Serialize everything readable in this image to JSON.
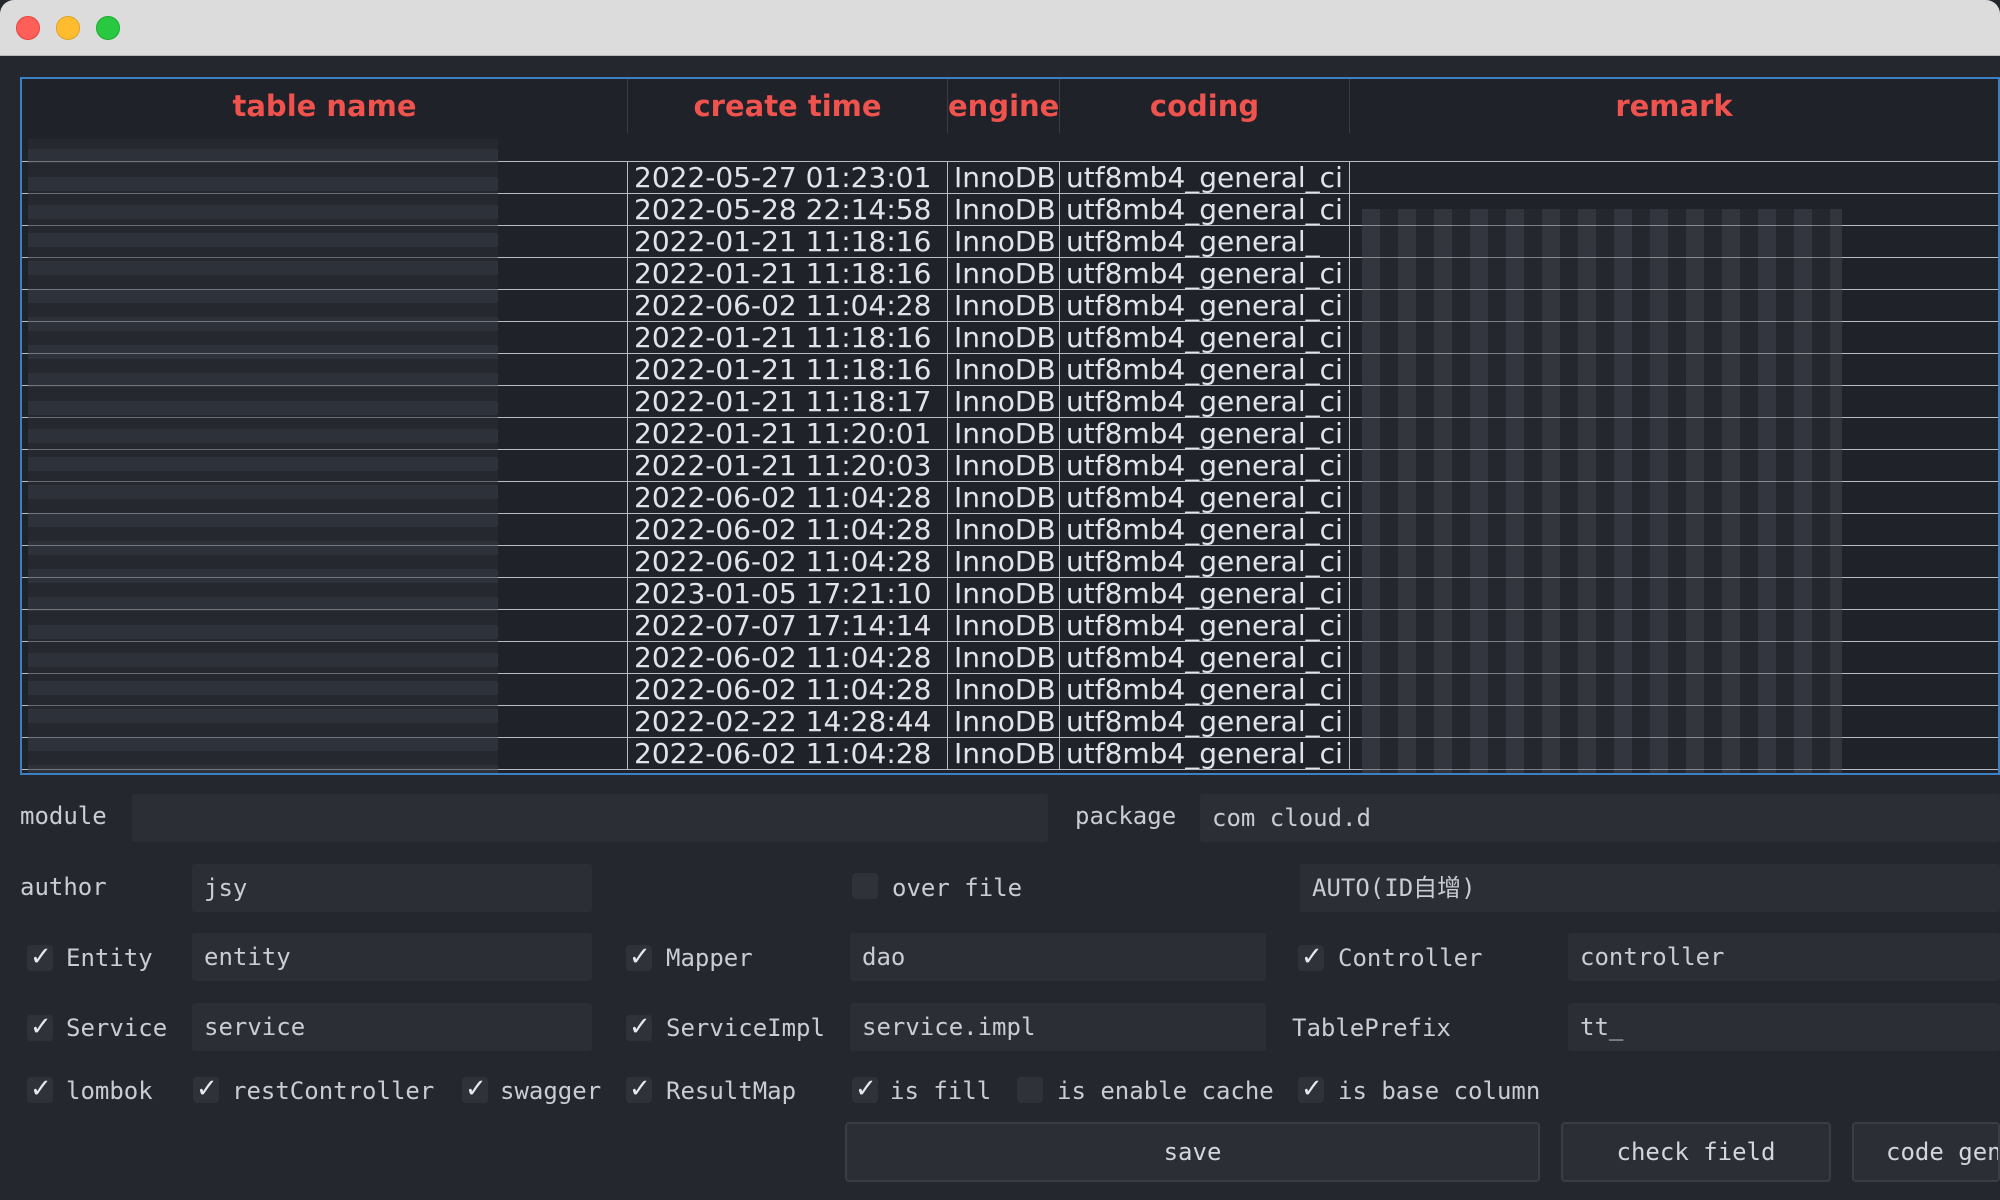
{
  "table": {
    "headers": [
      "table name",
      "create time",
      "engine",
      "coding",
      "remark"
    ],
    "rows": [
      {
        "time": "2022-05-27 01:23:01",
        "engine": "InnoDB",
        "coding": "utf8mb4_general_ci"
      },
      {
        "time": "2022-05-28 22:14:58",
        "engine": "InnoDB",
        "coding": "utf8mb4_general_ci"
      },
      {
        "time": "2022-01-21 11:18:16",
        "engine": "InnoDB",
        "coding": "utf8mb4_general_"
      },
      {
        "time": "2022-01-21 11:18:16",
        "engine": "InnoDB",
        "coding": "utf8mb4_general_ci"
      },
      {
        "time": "2022-06-02 11:04:28",
        "engine": "InnoDB",
        "coding": "utf8mb4_general_ci"
      },
      {
        "time": "2022-01-21 11:18:16",
        "engine": "InnoDB",
        "coding": "utf8mb4_general_ci"
      },
      {
        "time": "2022-01-21 11:18:16",
        "engine": "InnoDB",
        "coding": "utf8mb4_general_ci"
      },
      {
        "time": "2022-01-21 11:18:17",
        "engine": "InnoDB",
        "coding": "utf8mb4_general_ci"
      },
      {
        "time": "2022-01-21 11:20:01",
        "engine": "InnoDB",
        "coding": "utf8mb4_general_ci"
      },
      {
        "time": "2022-01-21 11:20:03",
        "engine": "InnoDB",
        "coding": "utf8mb4_general_ci"
      },
      {
        "time": "2022-06-02 11:04:28",
        "engine": "InnoDB",
        "coding": "utf8mb4_general_ci"
      },
      {
        "time": "2022-06-02 11:04:28",
        "engine": "InnoDB",
        "coding": "utf8mb4_general_ci"
      },
      {
        "time": "2022-06-02 11:04:28",
        "engine": "InnoDB",
        "coding": "utf8mb4_general_ci"
      },
      {
        "time": "2023-01-05 17:21:10",
        "engine": "InnoDB",
        "coding": "utf8mb4_general_ci"
      },
      {
        "time": "2022-07-07 17:14:14",
        "engine": "InnoDB",
        "coding": "utf8mb4_general_ci"
      },
      {
        "time": "2022-06-02 11:04:28",
        "engine": "InnoDB",
        "coding": "utf8mb4_general_ci"
      },
      {
        "time": "2022-06-02 11:04:28",
        "engine": "InnoDB",
        "coding": "utf8mb4_general_ci"
      },
      {
        "time": "2022-02-22 14:28:44",
        "engine": "InnoDB",
        "coding": "utf8mb4_general_ci"
      },
      {
        "time": "2022-06-02 11:04:28",
        "engine": "InnoDB",
        "coding": "utf8mb4_general_ci"
      }
    ]
  },
  "form": {
    "module_label": "module",
    "module_value": "",
    "package_label": "package",
    "package_value": "com      cloud.d",
    "author_label": "author",
    "author_value": "jsy",
    "over_file_label": "over file",
    "id_type_value": "AUTO(ID自增)",
    "entity_label": "Entity",
    "entity_value": "entity",
    "mapper_label": "Mapper",
    "mapper_value": "dao",
    "controller_label": "Controller",
    "controller_value": "controller",
    "service_label": "Service",
    "service_value": "service",
    "serviceimpl_label": "ServiceImpl",
    "serviceimpl_value": "service.impl",
    "tableprefix_label": "TablePrefix",
    "tableprefix_value": "tt_",
    "lombok_label": "lombok",
    "restcontroller_label": "restController",
    "swagger_label": "swagger",
    "resultmap_label": "ResultMap",
    "isfill_label": "is fill",
    "enablecache_label": "is enable cache",
    "basecolumn_label": "is base column"
  },
  "checkboxes": {
    "over_file": false,
    "entity": true,
    "mapper": true,
    "controller": true,
    "service": true,
    "serviceimpl": true,
    "lombok": true,
    "restcontroller": true,
    "swagger": true,
    "resultmap": true,
    "is_fill": true,
    "enable_cache": false,
    "base_column": true
  },
  "buttons": {
    "save": "save",
    "check_field": "check field",
    "code_gen": "code gen"
  }
}
